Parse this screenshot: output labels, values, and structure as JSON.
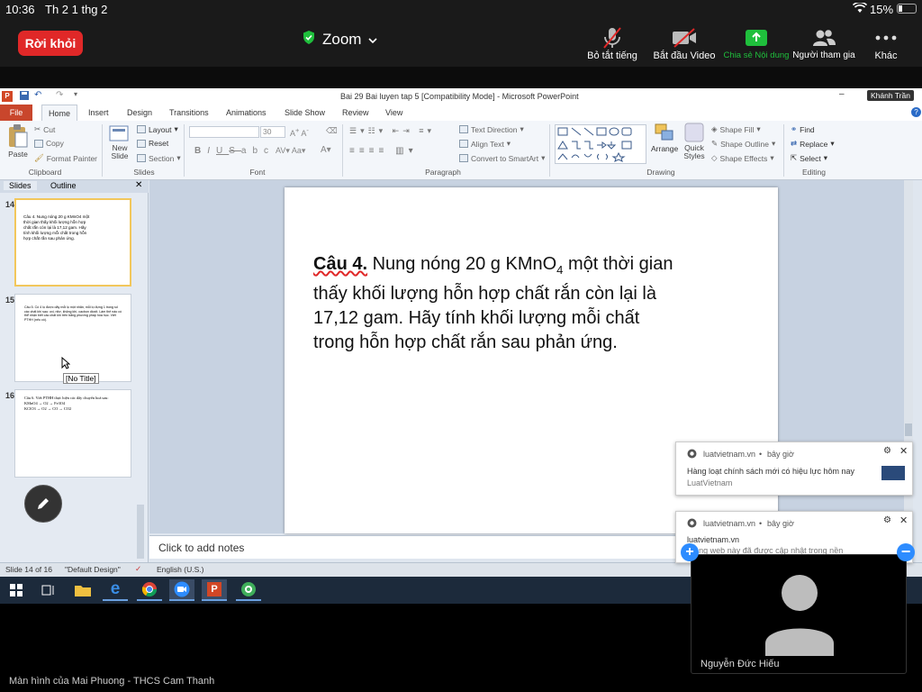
{
  "ios": {
    "time": "10:36",
    "date": "Th 2 1 thg 2",
    "battery": "15%"
  },
  "zoom": {
    "leave_label": "Rời khỏi",
    "title": "Zoom",
    "tools": [
      {
        "label": "Bỏ tắt tiếng"
      },
      {
        "label": "Bắt đầu Video"
      },
      {
        "label": "Chia sẻ Nội dung"
      },
      {
        "label": "Người tham gia"
      },
      {
        "label": "Khác"
      }
    ],
    "tooltip": "Khánh Trần",
    "share_caption": "Màn hình của Mai Phuong - THCS Cam Thanh",
    "participant_name": "Nguyễn Đức Hiếu",
    "colors": {
      "leave": "#e02828",
      "share": "#1fbf3c"
    }
  },
  "ppt": {
    "window_title": "Bai 29 Bai luyen tap 5 [Compatibility Mode] - Microsoft PowerPoint",
    "tabs": [
      "File",
      "Home",
      "Insert",
      "Design",
      "Transitions",
      "Animations",
      "Slide Show",
      "Review",
      "View"
    ],
    "ribbon": {
      "paste": "Paste",
      "cut": "Cut",
      "copy": "Copy",
      "format_painter": "Format Painter",
      "clipboard": "Clipboard",
      "new_slide": "New Slide",
      "layout": "Layout",
      "reset": "Reset",
      "section": "Section",
      "slides": "Slides",
      "font_size": "30",
      "font": "Font",
      "text_direction": "Text Direction",
      "align_text": "Align Text",
      "convert_smartart": "Convert to SmartArt",
      "paragraph": "Paragraph",
      "arrange": "Arrange",
      "quick_styles": "Quick Styles",
      "shape_fill": "Shape Fill",
      "shape_outline": "Shape Outline",
      "shape_effects": "Shape Effects",
      "drawing": "Drawing",
      "find": "Find",
      "replace": "Replace",
      "select": "Select",
      "editing": "Editing"
    },
    "pane_tabs": [
      "Slides",
      "Outline"
    ],
    "thumbnails": [
      {
        "num": "14",
        "text": "Câu 4. Nung nóng 20 g KMnO4 một thời gian thấy khối lượng hỗn hợp chất rắn còn lại là 17,12 gam. Hãy tính khối lượng mỗi chất trong hỗn hợp chất rắn sau phản ứng."
      },
      {
        "num": "15",
        "text": "Câu 5. Có 4 lọ được dãy mỗi lọ một nhãn, mỗi lọ đựng 1 trong số các chất khí sau: oxi, nitơ, không khí, cacbon dioxit. Làm thế nào có thể nhận biết các chất khí trên bằng phương pháp hóa học. Viết PTHH (nếu có)."
      },
      {
        "num": "16",
        "text": "Câu 6. Viết PTHH thực hiện các dãy chuyển hoá sau:",
        "lines": [
          "KMnO4 → O2 → Fe3O4",
          "KClO3 → O2 → CO → CO2"
        ]
      }
    ],
    "thumb_tooltip": "[No Title]",
    "slide": {
      "label": "Câu 4.",
      "text_part1": " Nung nóng 20 g KMnO",
      "sub": "4",
      "text_part2": " một thời gian thấy khối lượng hỗn hợp chất rắn còn lại là 17,12 gam. Hãy tính khối lượng mỗi chất trong hỗn hợp chất rắn sau phản ứng."
    },
    "notes_placeholder": "Click to add notes",
    "status": {
      "slide": "Slide 14 of 16",
      "design": "\"Default Design\"",
      "language": "English (U.S.)"
    }
  },
  "notifications": [
    {
      "source": "luatvietnam.vn",
      "time": "bây giờ",
      "title": "Hàng loạt chính sách mới có hiệu lực hôm nay",
      "sub": "LuatVietnam"
    },
    {
      "source": "luatvietnam.vn",
      "time": "bây giờ",
      "title": "luatvietnam.vn",
      "sub": "Trang web này đã được cập nhật trong nền"
    }
  ]
}
